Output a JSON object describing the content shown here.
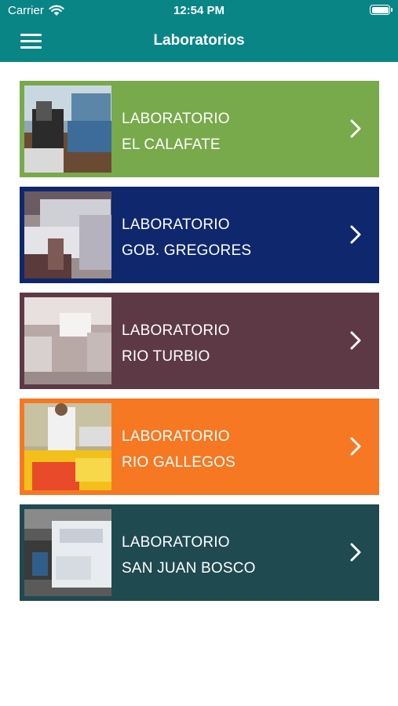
{
  "status_bar": {
    "carrier": "Carrier",
    "time": "12:54 PM",
    "icons": [
      "wifi-icon",
      "battery-icon"
    ]
  },
  "nav": {
    "title": "Laboratorios",
    "menu_icon": "hamburger-menu-icon",
    "color": "#0a8586"
  },
  "labs": [
    {
      "line1": "LABORATORIO",
      "line2": "EL CALAFATE",
      "color": "#78a94b",
      "image": "microscope-lab-photo"
    },
    {
      "line1": "LABORATORIO",
      "line2": "GOB. GREGORES",
      "color": "#0f276d",
      "image": "sample-tubes-photo"
    },
    {
      "line1": "LABORATORIO",
      "line2": "RIO TURBIO",
      "color": "#5d3946",
      "image": "lab-room-photo"
    },
    {
      "line1": "LABORATORIO",
      "line2": "RIO GALLEGOS",
      "color": "#f67822",
      "image": "technician-tube-racks-photo"
    },
    {
      "line1": "LABORATORIO",
      "line2": "SAN JUAN BOSCO",
      "color": "#1f4a50",
      "image": "analyzer-machine-photo"
    }
  ]
}
